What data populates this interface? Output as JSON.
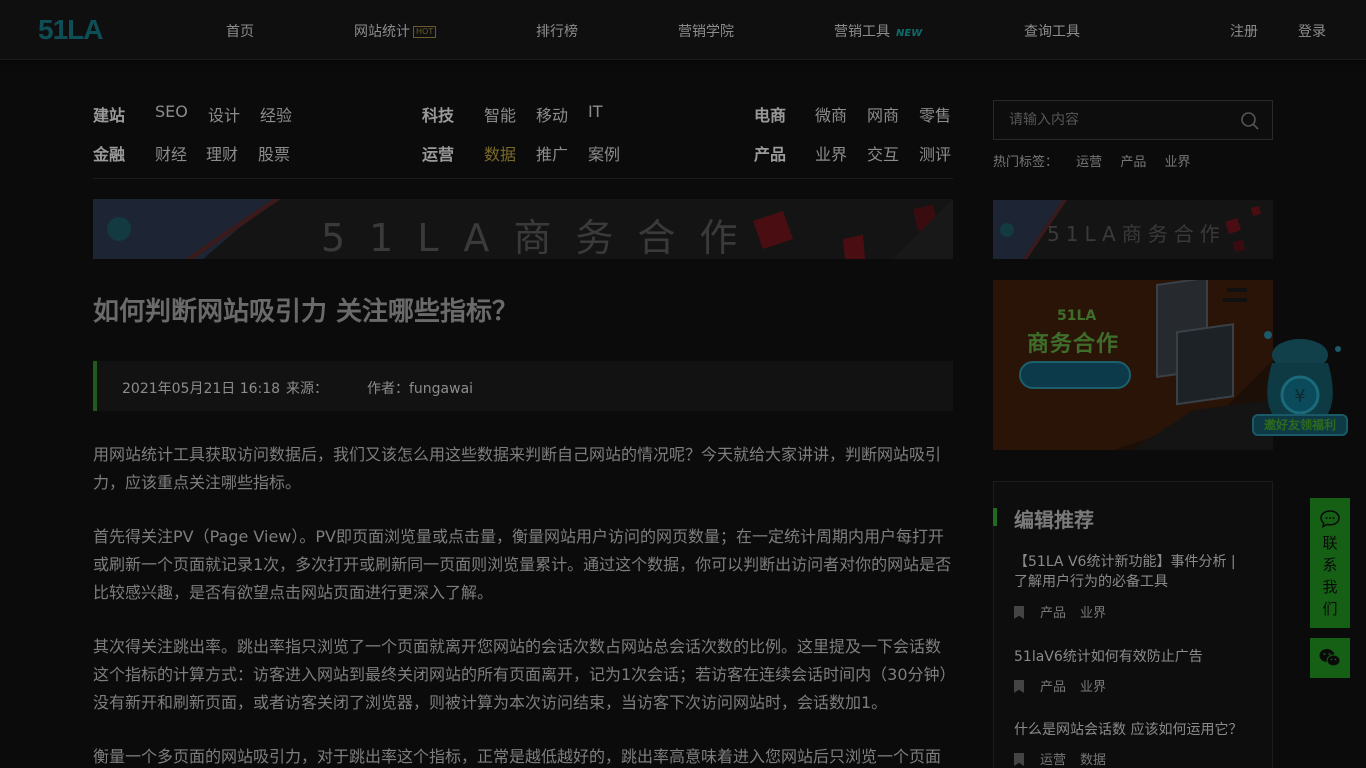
{
  "header": {
    "logo": "51LA",
    "nav": [
      "首页",
      "网站统计",
      "排行榜",
      "营销学院",
      "营销工具",
      "查询工具"
    ],
    "hot_badge": "HOT",
    "new_badge": "NEW",
    "register": "注册",
    "login": "登录"
  },
  "categories": {
    "group1_row1": [
      "建站",
      "SEO",
      "设计",
      "经验"
    ],
    "group1_row2": [
      "金融",
      "财经",
      "理财",
      "股票"
    ],
    "group2_row1": [
      "科技",
      "智能",
      "移动",
      "IT"
    ],
    "group2_row2": [
      "运营",
      "数据",
      "推广",
      "案例"
    ],
    "group3_row1": [
      "电商",
      "微商",
      "网商",
      "零售"
    ],
    "group3_row2": [
      "产品",
      "业界",
      "交互",
      "测评"
    ]
  },
  "search": {
    "placeholder": "请输入内容",
    "hot_label": "热门标签：",
    "hot_tags": [
      "运营",
      "产品",
      "业界"
    ]
  },
  "banners": {
    "wide_text": "51LA商务合作",
    "side_text": "51LA商务合作",
    "promo_brand": "51LA",
    "promo_title": "商务合作",
    "float_badge": "邀好友领福利"
  },
  "article": {
    "title": "如何判断网站吸引力 关注哪些指标？",
    "date": "2021年05月21日 16:18",
    "source_label": "来源：",
    "author": "作者：fungawai",
    "paragraphs": [
      "用网站统计工具获取访问数据后，我们又该怎么用这些数据来判断自己网站的情况呢？今天就给大家讲讲，判断网站吸引力，应该重点关注哪些指标。",
      "首先得关注PV（Page View）。PV即页面浏览量或点击量，衡量网站用户访问的网页数量；在一定统计周期内用户每打开或刷新一个页面就记录1次，多次打开或刷新同一页面则浏览量累计。通过这个数据，你可以判断出访问者对你的网站是否比较感兴趣，是否有欲望点击网站页面进行更深入了解。",
      "其次得关注跳出率。跳出率指只浏览了一个页面就离开您网站的会话次数占网站总会话次数的比例。这里提及一下会话数这个指标的计算方式：访客进入网站到最终关闭网站的所有页面离开，记为1次会话；若访客在连续会话时间内（30分钟）没有新开和刷新页面，或者访客关闭了浏览器，则被计算为本次访问结束，当访客下次访问网站时，会话数加1。",
      "衡量一个多页面的网站吸引力，对于跳出率这个指标，正常是越低越好的，跳出率高意味着进入您网站后只浏览一个页面"
    ]
  },
  "recommend": {
    "heading": "编辑推荐",
    "items": [
      {
        "title": "【51LA V6统计新功能】事件分析 | 了解用户行为的必备工具",
        "tags": [
          "产品",
          "业界"
        ]
      },
      {
        "title": "51laV6统计如何有效防止广告",
        "tags": [
          "产品",
          "业界"
        ]
      },
      {
        "title": "什么是网站会话数 应该如何运用它？",
        "tags": [
          "运营",
          "数据"
        ]
      }
    ]
  },
  "contact": {
    "label": [
      "联",
      "系",
      "我",
      "们"
    ]
  }
}
